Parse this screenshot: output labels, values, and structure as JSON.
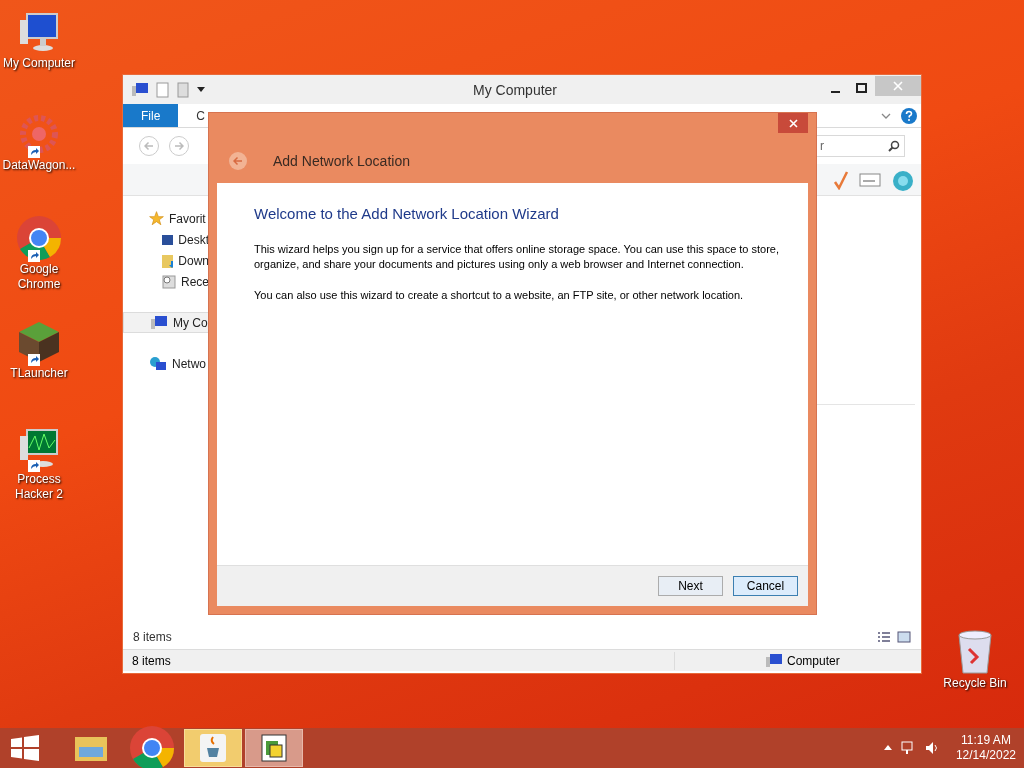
{
  "desktop_icons": [
    {
      "label": "My Computer",
      "kind": "computer",
      "shortcut": false
    },
    {
      "label": "DataWagon...",
      "kind": "gear",
      "shortcut": true
    },
    {
      "label": "Google Chrome",
      "kind": "chrome",
      "shortcut": true
    },
    {
      "label": "TLauncher",
      "kind": "block",
      "shortcut": true
    },
    {
      "label": "Process Hacker 2",
      "kind": "monitor",
      "shortcut": true
    },
    {
      "label": "Recycle Bin",
      "kind": "bin",
      "shortcut": false
    }
  ],
  "explorer": {
    "title": "My Computer",
    "ribbon_tabs": [
      {
        "label": "File",
        "selected": true
      },
      {
        "label": "C",
        "selected": false
      }
    ],
    "search": {
      "value": "r"
    },
    "sidebar": [
      {
        "label": "Favorit",
        "kind": "star",
        "selected": false,
        "children": [
          {
            "label": "Deskt",
            "kind": "desktop",
            "selected": false
          },
          {
            "label": "Down",
            "kind": "download",
            "selected": false
          },
          {
            "label": "Rece",
            "kind": "recent",
            "selected": false
          }
        ]
      },
      {
        "label": "My Co",
        "kind": "computer",
        "selected": true
      },
      {
        "label": "Netwo",
        "kind": "network",
        "selected": false
      }
    ],
    "item_count": "8 items",
    "status_bar": {
      "count": "8 items",
      "location": "Computer"
    }
  },
  "dialog": {
    "title": "Add Network Location",
    "heading": "Welcome to the Add Network Location Wizard",
    "paragraphs": [
      "This wizard helps you sign up for a service that offers online storage space.  You can use this space to store, organize, and share your documents and pictures using only a web browser and Internet connection.",
      "You can also use this wizard to create a shortcut to a website, an FTP site, or other network location."
    ],
    "buttons": [
      {
        "label": "Next",
        "selected": false
      },
      {
        "label": "Cancel",
        "selected": true
      }
    ]
  },
  "taskbar": {
    "apps": [
      {
        "kind": "folder",
        "selected": false,
        "open": false
      },
      {
        "kind": "chrome",
        "selected": false,
        "open": false
      },
      {
        "kind": "java",
        "selected": true,
        "open": true
      },
      {
        "kind": "app",
        "selected": false,
        "open": true
      }
    ],
    "time": "11:19 AM",
    "date": "12/14/2022"
  }
}
